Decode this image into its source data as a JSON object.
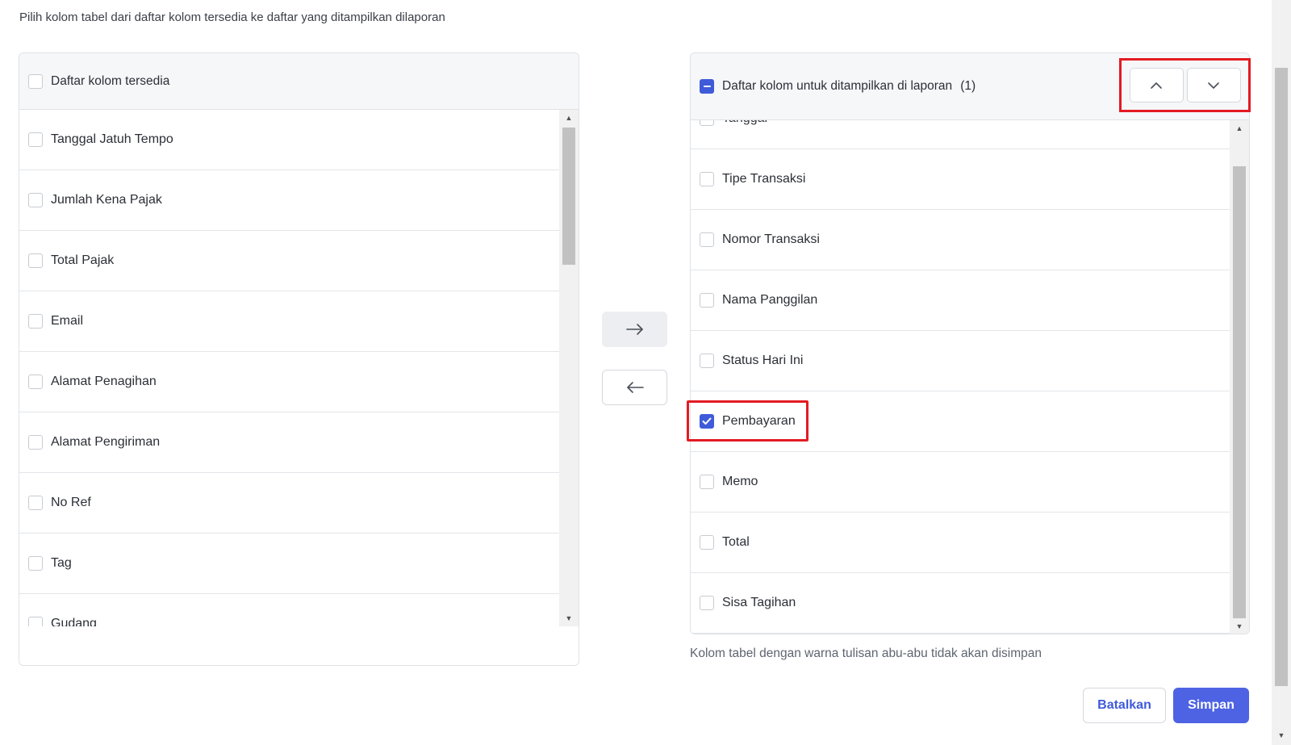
{
  "instruction": "Pilih kolom tabel dari daftar kolom tersedia ke daftar yang ditampilkan dilaporan",
  "available": {
    "header_label": "Daftar kolom tersedia",
    "items": [
      {
        "label": "Tanggal Jatuh Tempo",
        "checked": false
      },
      {
        "label": "Jumlah Kena Pajak",
        "checked": false
      },
      {
        "label": "Total Pajak",
        "checked": false
      },
      {
        "label": "Email",
        "checked": false
      },
      {
        "label": "Alamat Penagihan",
        "checked": false
      },
      {
        "label": "Alamat Pengiriman",
        "checked": false
      },
      {
        "label": "No Ref",
        "checked": false
      },
      {
        "label": "Tag",
        "checked": false
      },
      {
        "label": "Gudang",
        "checked": false
      }
    ]
  },
  "selected": {
    "header_label": "Daftar kolom untuk ditampilkan di laporan",
    "header_count": "(1)",
    "items": [
      {
        "label": "Tanggal",
        "checked": false
      },
      {
        "label": "Tipe Transaksi",
        "checked": false
      },
      {
        "label": "Nomor Transaksi",
        "checked": false
      },
      {
        "label": "Nama Panggilan",
        "checked": false
      },
      {
        "label": "Status Hari Ini",
        "checked": false
      },
      {
        "label": "Pembayaran",
        "checked": true
      },
      {
        "label": "Memo",
        "checked": false
      },
      {
        "label": "Total",
        "checked": false
      },
      {
        "label": "Sisa Tagihan",
        "checked": false
      }
    ]
  },
  "footnote": "Kolom tabel dengan warna tulisan abu-abu tidak akan disimpan",
  "buttons": {
    "cancel": "Batalkan",
    "save": "Simpan"
  },
  "icons": {
    "move_right": "arrow-right-icon",
    "move_left": "arrow-left-icon",
    "move_up": "chevron-up-icon",
    "move_down": "chevron-down-icon"
  },
  "colors": {
    "primary": "#3f5bd9",
    "save_button": "#4d63e3",
    "highlight": "#e31b23"
  }
}
